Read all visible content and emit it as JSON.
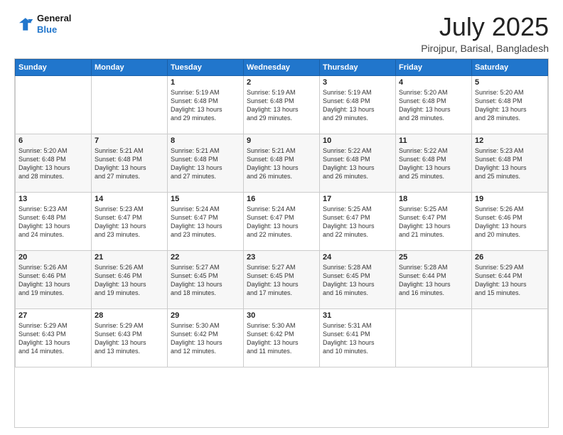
{
  "logo": {
    "line1": "General",
    "line2": "Blue"
  },
  "title": "July 2025",
  "subtitle": "Pirojpur, Barisal, Bangladesh",
  "headers": [
    "Sunday",
    "Monday",
    "Tuesday",
    "Wednesday",
    "Thursday",
    "Friday",
    "Saturday"
  ],
  "weeks": [
    [
      {
        "day": "",
        "info": ""
      },
      {
        "day": "",
        "info": ""
      },
      {
        "day": "1",
        "info": "Sunrise: 5:19 AM\nSunset: 6:48 PM\nDaylight: 13 hours\nand 29 minutes."
      },
      {
        "day": "2",
        "info": "Sunrise: 5:19 AM\nSunset: 6:48 PM\nDaylight: 13 hours\nand 29 minutes."
      },
      {
        "day": "3",
        "info": "Sunrise: 5:19 AM\nSunset: 6:48 PM\nDaylight: 13 hours\nand 29 minutes."
      },
      {
        "day": "4",
        "info": "Sunrise: 5:20 AM\nSunset: 6:48 PM\nDaylight: 13 hours\nand 28 minutes."
      },
      {
        "day": "5",
        "info": "Sunrise: 5:20 AM\nSunset: 6:48 PM\nDaylight: 13 hours\nand 28 minutes."
      }
    ],
    [
      {
        "day": "6",
        "info": "Sunrise: 5:20 AM\nSunset: 6:48 PM\nDaylight: 13 hours\nand 28 minutes."
      },
      {
        "day": "7",
        "info": "Sunrise: 5:21 AM\nSunset: 6:48 PM\nDaylight: 13 hours\nand 27 minutes."
      },
      {
        "day": "8",
        "info": "Sunrise: 5:21 AM\nSunset: 6:48 PM\nDaylight: 13 hours\nand 27 minutes."
      },
      {
        "day": "9",
        "info": "Sunrise: 5:21 AM\nSunset: 6:48 PM\nDaylight: 13 hours\nand 26 minutes."
      },
      {
        "day": "10",
        "info": "Sunrise: 5:22 AM\nSunset: 6:48 PM\nDaylight: 13 hours\nand 26 minutes."
      },
      {
        "day": "11",
        "info": "Sunrise: 5:22 AM\nSunset: 6:48 PM\nDaylight: 13 hours\nand 25 minutes."
      },
      {
        "day": "12",
        "info": "Sunrise: 5:23 AM\nSunset: 6:48 PM\nDaylight: 13 hours\nand 25 minutes."
      }
    ],
    [
      {
        "day": "13",
        "info": "Sunrise: 5:23 AM\nSunset: 6:48 PM\nDaylight: 13 hours\nand 24 minutes."
      },
      {
        "day": "14",
        "info": "Sunrise: 5:23 AM\nSunset: 6:47 PM\nDaylight: 13 hours\nand 23 minutes."
      },
      {
        "day": "15",
        "info": "Sunrise: 5:24 AM\nSunset: 6:47 PM\nDaylight: 13 hours\nand 23 minutes."
      },
      {
        "day": "16",
        "info": "Sunrise: 5:24 AM\nSunset: 6:47 PM\nDaylight: 13 hours\nand 22 minutes."
      },
      {
        "day": "17",
        "info": "Sunrise: 5:25 AM\nSunset: 6:47 PM\nDaylight: 13 hours\nand 22 minutes."
      },
      {
        "day": "18",
        "info": "Sunrise: 5:25 AM\nSunset: 6:47 PM\nDaylight: 13 hours\nand 21 minutes."
      },
      {
        "day": "19",
        "info": "Sunrise: 5:26 AM\nSunset: 6:46 PM\nDaylight: 13 hours\nand 20 minutes."
      }
    ],
    [
      {
        "day": "20",
        "info": "Sunrise: 5:26 AM\nSunset: 6:46 PM\nDaylight: 13 hours\nand 19 minutes."
      },
      {
        "day": "21",
        "info": "Sunrise: 5:26 AM\nSunset: 6:46 PM\nDaylight: 13 hours\nand 19 minutes."
      },
      {
        "day": "22",
        "info": "Sunrise: 5:27 AM\nSunset: 6:45 PM\nDaylight: 13 hours\nand 18 minutes."
      },
      {
        "day": "23",
        "info": "Sunrise: 5:27 AM\nSunset: 6:45 PM\nDaylight: 13 hours\nand 17 minutes."
      },
      {
        "day": "24",
        "info": "Sunrise: 5:28 AM\nSunset: 6:45 PM\nDaylight: 13 hours\nand 16 minutes."
      },
      {
        "day": "25",
        "info": "Sunrise: 5:28 AM\nSunset: 6:44 PM\nDaylight: 13 hours\nand 16 minutes."
      },
      {
        "day": "26",
        "info": "Sunrise: 5:29 AM\nSunset: 6:44 PM\nDaylight: 13 hours\nand 15 minutes."
      }
    ],
    [
      {
        "day": "27",
        "info": "Sunrise: 5:29 AM\nSunset: 6:43 PM\nDaylight: 13 hours\nand 14 minutes."
      },
      {
        "day": "28",
        "info": "Sunrise: 5:29 AM\nSunset: 6:43 PM\nDaylight: 13 hours\nand 13 minutes."
      },
      {
        "day": "29",
        "info": "Sunrise: 5:30 AM\nSunset: 6:42 PM\nDaylight: 13 hours\nand 12 minutes."
      },
      {
        "day": "30",
        "info": "Sunrise: 5:30 AM\nSunset: 6:42 PM\nDaylight: 13 hours\nand 11 minutes."
      },
      {
        "day": "31",
        "info": "Sunrise: 5:31 AM\nSunset: 6:41 PM\nDaylight: 13 hours\nand 10 minutes."
      },
      {
        "day": "",
        "info": ""
      },
      {
        "day": "",
        "info": ""
      }
    ]
  ]
}
